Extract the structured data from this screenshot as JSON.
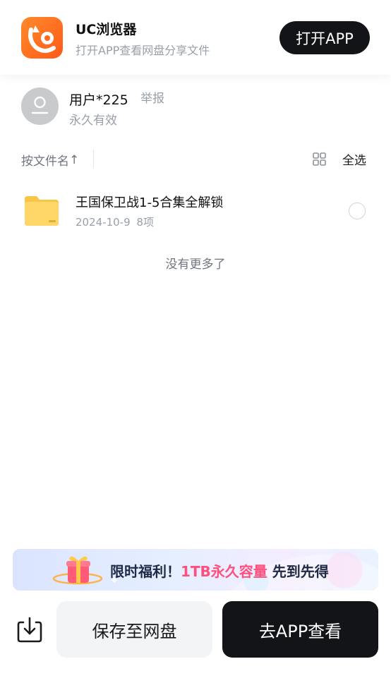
{
  "header": {
    "app_name": "UC浏览器",
    "app_subtitle": "打开APP查看网盘分享文件",
    "open_app_label": "打开APP"
  },
  "user": {
    "name": "用户*225",
    "report_label": "举报",
    "validity": "永久有效"
  },
  "toolbar": {
    "sort_label": "按文件名",
    "sort_arrow": "↑",
    "select_all_label": "全选",
    "grid_icon": "grid-view-icon"
  },
  "files": [
    {
      "name": "王国保卫战1-5合集全解锁",
      "date": "2024-10-9",
      "count": "8项",
      "icon": "folder-icon"
    }
  ],
  "list_end_text": "没有更多了",
  "promo": {
    "prefix": "限时福利！",
    "highlight": "1TB永久容量",
    "suffix": " 先到先得"
  },
  "actions": {
    "save_label": "保存至网盘",
    "go_app_label": "去APP查看"
  },
  "colors": {
    "accent_dark": "#121418",
    "brand_orange": "#ff6a1f",
    "promo_pink": "#ff4f7d",
    "muted_text": "#9aa0a8"
  }
}
